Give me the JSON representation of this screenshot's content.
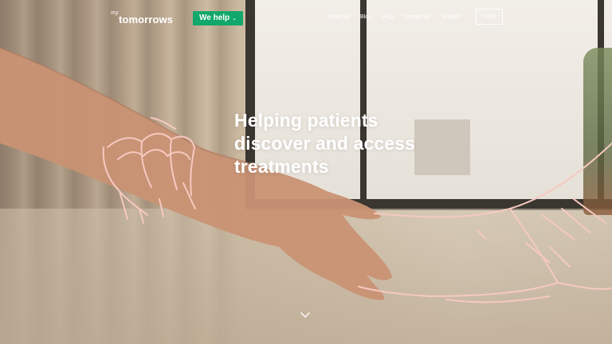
{
  "brand": {
    "logo_prefix": "my",
    "logo_name": "tomorrows"
  },
  "header": {
    "cta_label": "We help",
    "nav": [
      {
        "label": "About us"
      },
      {
        "label": "Blog"
      },
      {
        "label": "FAQ"
      },
      {
        "label": "Contact us"
      },
      {
        "label": "English"
      }
    ],
    "login_label": "Login"
  },
  "hero": {
    "headline_lines": [
      "Helping patients",
      "discover and access",
      "treatments"
    ]
  },
  "icons": {
    "cta_chevron": "chevron-down-icon",
    "language_chevron": "chevron-down-icon",
    "scroll": "chevron-down-icon"
  },
  "colors": {
    "accent": "#12a86b",
    "illustration": "#f6c9c0",
    "text": "#ffffff"
  }
}
